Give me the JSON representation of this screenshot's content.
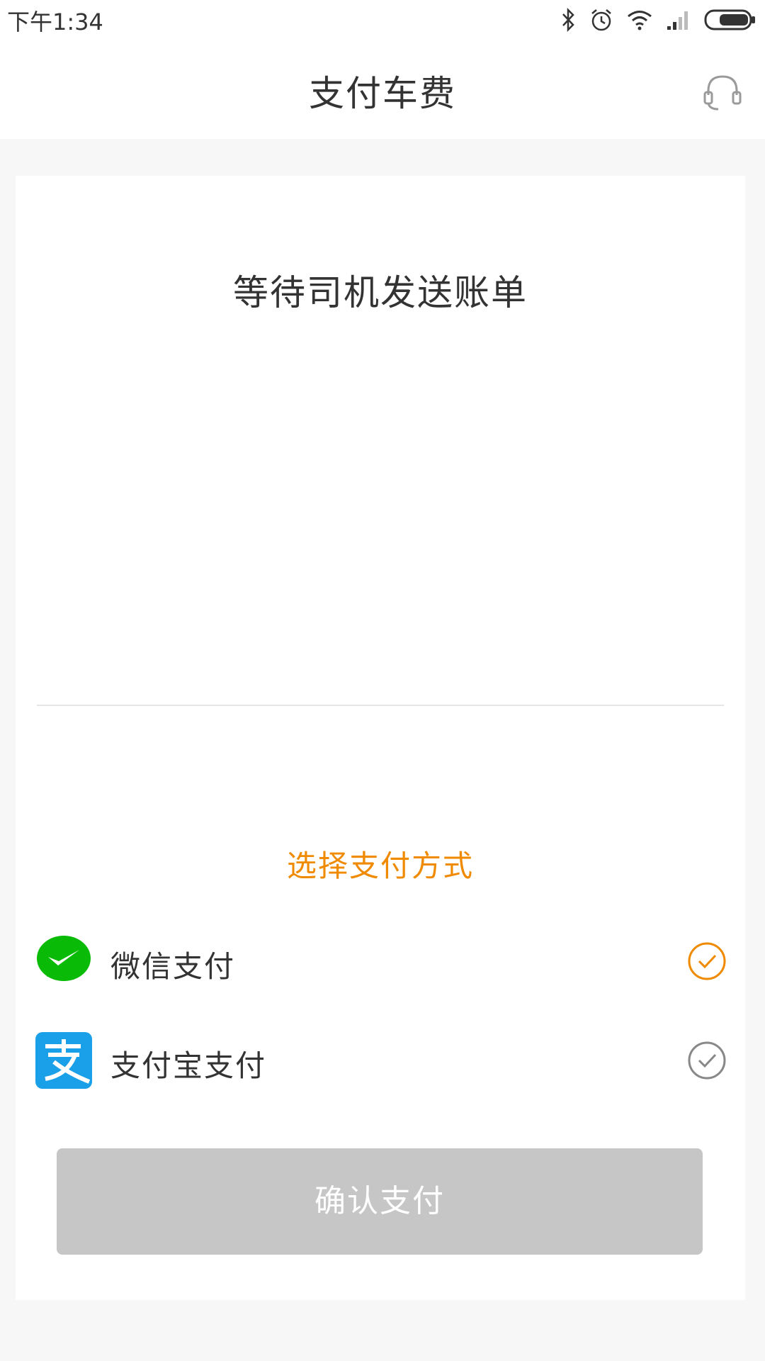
{
  "status_bar": {
    "time": "下午1:34",
    "icons": [
      "bluetooth-icon",
      "alarm-icon",
      "wifi-icon",
      "signal-icon",
      "battery-icon"
    ]
  },
  "header": {
    "title": "支付车费",
    "right_icon": "headset-icon"
  },
  "bill": {
    "status_text": "等待司机发送账单"
  },
  "payment": {
    "section_label": "选择支付方式",
    "methods": [
      {
        "label": "微信支付",
        "icon": "wechat-pay-icon",
        "selected": true
      },
      {
        "label": "支付宝支付",
        "icon": "alipay-icon",
        "selected": false
      }
    ],
    "confirm_label": "确认支付",
    "confirm_enabled": false
  },
  "colors": {
    "accent": "#f08a00",
    "wechat_green": "#09bb07",
    "alipay_blue": "#1aa0e8",
    "disabled_button": "#c6c6c6",
    "unselected_check": "#888888"
  }
}
